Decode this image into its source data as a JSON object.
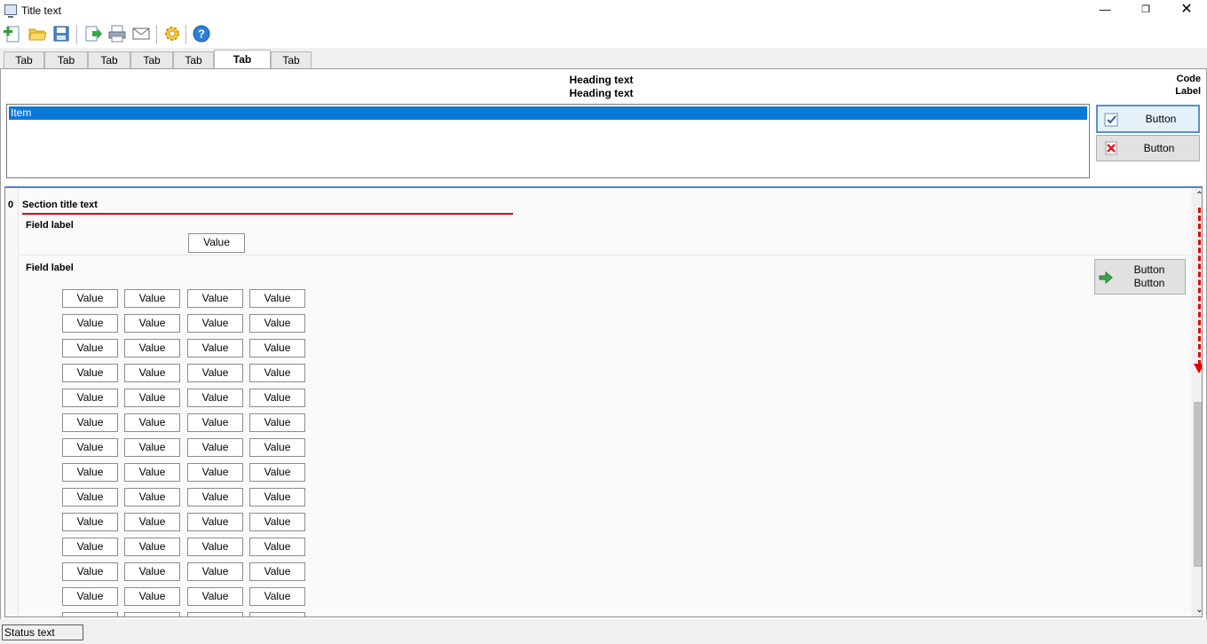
{
  "window": {
    "title": "Title text"
  },
  "toolbar": {
    "icons": [
      "new-document-icon",
      "open-folder-icon",
      "save-icon",
      "export-icon",
      "print-icon",
      "mail-icon",
      "settings-icon",
      "help-icon"
    ]
  },
  "tabs": [
    "Tab",
    "Tab",
    "Tab",
    "Tab",
    "Tab",
    "Tab",
    "Tab"
  ],
  "active_tab_index": 5,
  "sheet": {
    "heading_line1": "Heading text",
    "heading_line2": "Heading text",
    "form_code": "Code",
    "sheet_name": "Label"
  },
  "sheet_list": {
    "items": [
      "Item"
    ]
  },
  "buttons": {
    "add_sheet": "Button",
    "delete": "Button",
    "input_direction_line1": "Button",
    "input_direction_line2": "Button"
  },
  "section": {
    "number": "0",
    "title": "Section title text",
    "main_code_label": "Field label",
    "extra_codes_label": "Field label",
    "code_mask": "Value"
  },
  "status_bar": {
    "text": "Status text"
  },
  "colors": {
    "selection": "#0a78d7",
    "annotation": "#e00000",
    "default_button_border": "#5b8ec9"
  }
}
